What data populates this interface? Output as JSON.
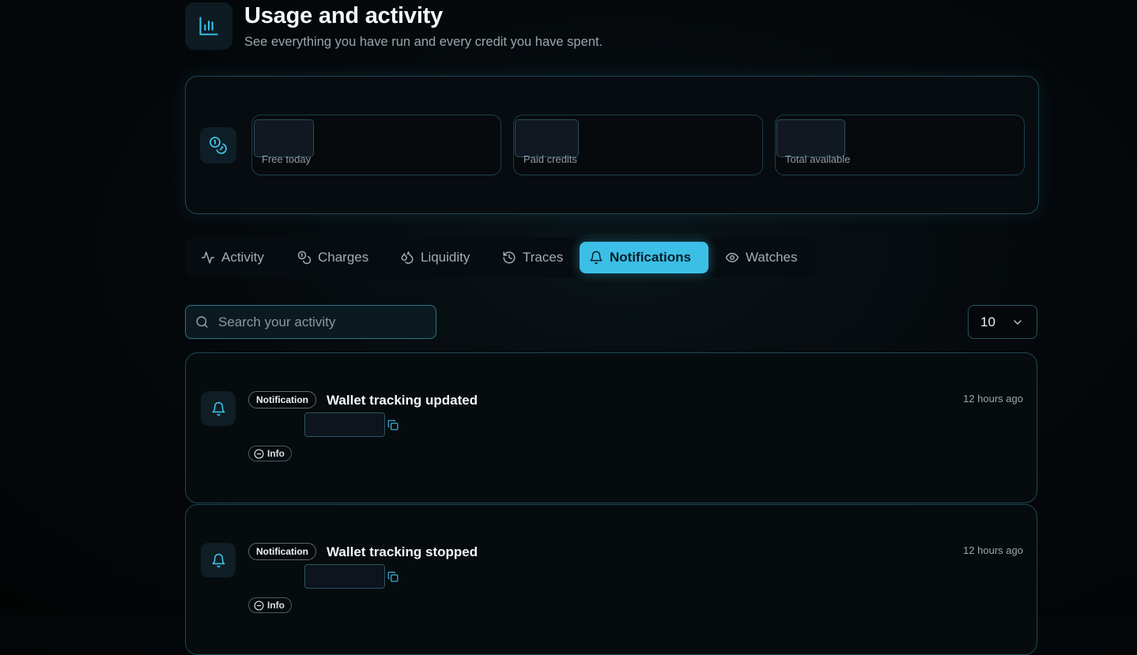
{
  "header": {
    "title": "Usage and activity",
    "subtitle": "See everything you have run and every credit you have spent.",
    "icon": "bar-chart-icon"
  },
  "credits": {
    "icon": "coins-icon",
    "stats": [
      {
        "label": "Free today"
      },
      {
        "label": "Paid credits"
      },
      {
        "label": "Total available"
      }
    ]
  },
  "tabs": [
    {
      "label": "Activity",
      "icon": "activity-icon",
      "active": false
    },
    {
      "label": "Charges",
      "icon": "coins-icon",
      "active": false
    },
    {
      "label": "Liquidity",
      "icon": "droplets-icon",
      "active": false
    },
    {
      "label": "Traces",
      "icon": "history-icon",
      "active": false
    },
    {
      "label": "Notifications",
      "icon": "bell-icon",
      "active": true
    },
    {
      "label": "Watches",
      "icon": "eye-icon",
      "active": false
    }
  ],
  "search": {
    "placeholder": "Search your activity",
    "value": ""
  },
  "page_size": {
    "value": "10"
  },
  "notifications": [
    {
      "type": "Notification",
      "title": "Wallet tracking updated",
      "level": "Info",
      "time": "12 hours ago"
    },
    {
      "type": "Notification",
      "title": "Wallet tracking stopped",
      "level": "Info",
      "time": "12 hours ago"
    }
  ],
  "colors": {
    "accent": "#3cbfe6",
    "border": "#1d4a55",
    "background": "#05090c"
  }
}
